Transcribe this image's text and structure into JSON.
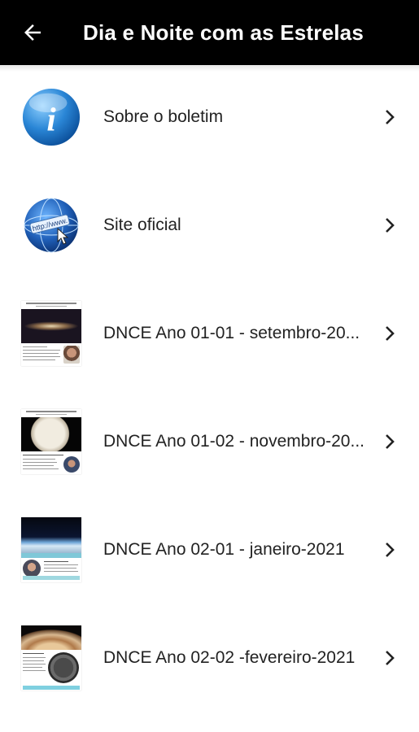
{
  "appbar": {
    "title": "Dia e Noite com as Estrelas",
    "back_icon": "arrow-left-icon"
  },
  "colors": {
    "appbar_bg": "#000000",
    "appbar_fg": "#ffffff",
    "info_icon_blue": "#2a7fd0",
    "text": "#222222"
  },
  "items": [
    {
      "label": "Sobre o boletim",
      "icon": "info-icon"
    },
    {
      "label": "Site oficial",
      "icon": "globe-web-icon"
    },
    {
      "label": "DNCE Ano 01-01 - setembro-20...",
      "icon": "newsletter-thumbnail"
    },
    {
      "label": "DNCE Ano 01-02 - novembro-20...",
      "icon": "newsletter-thumbnail"
    },
    {
      "label": "DNCE Ano 02-01 - janeiro-2021",
      "icon": "newsletter-thumbnail"
    },
    {
      "label": "DNCE Ano 02-02 -fevereiro-2021",
      "icon": "newsletter-thumbnail"
    }
  ]
}
